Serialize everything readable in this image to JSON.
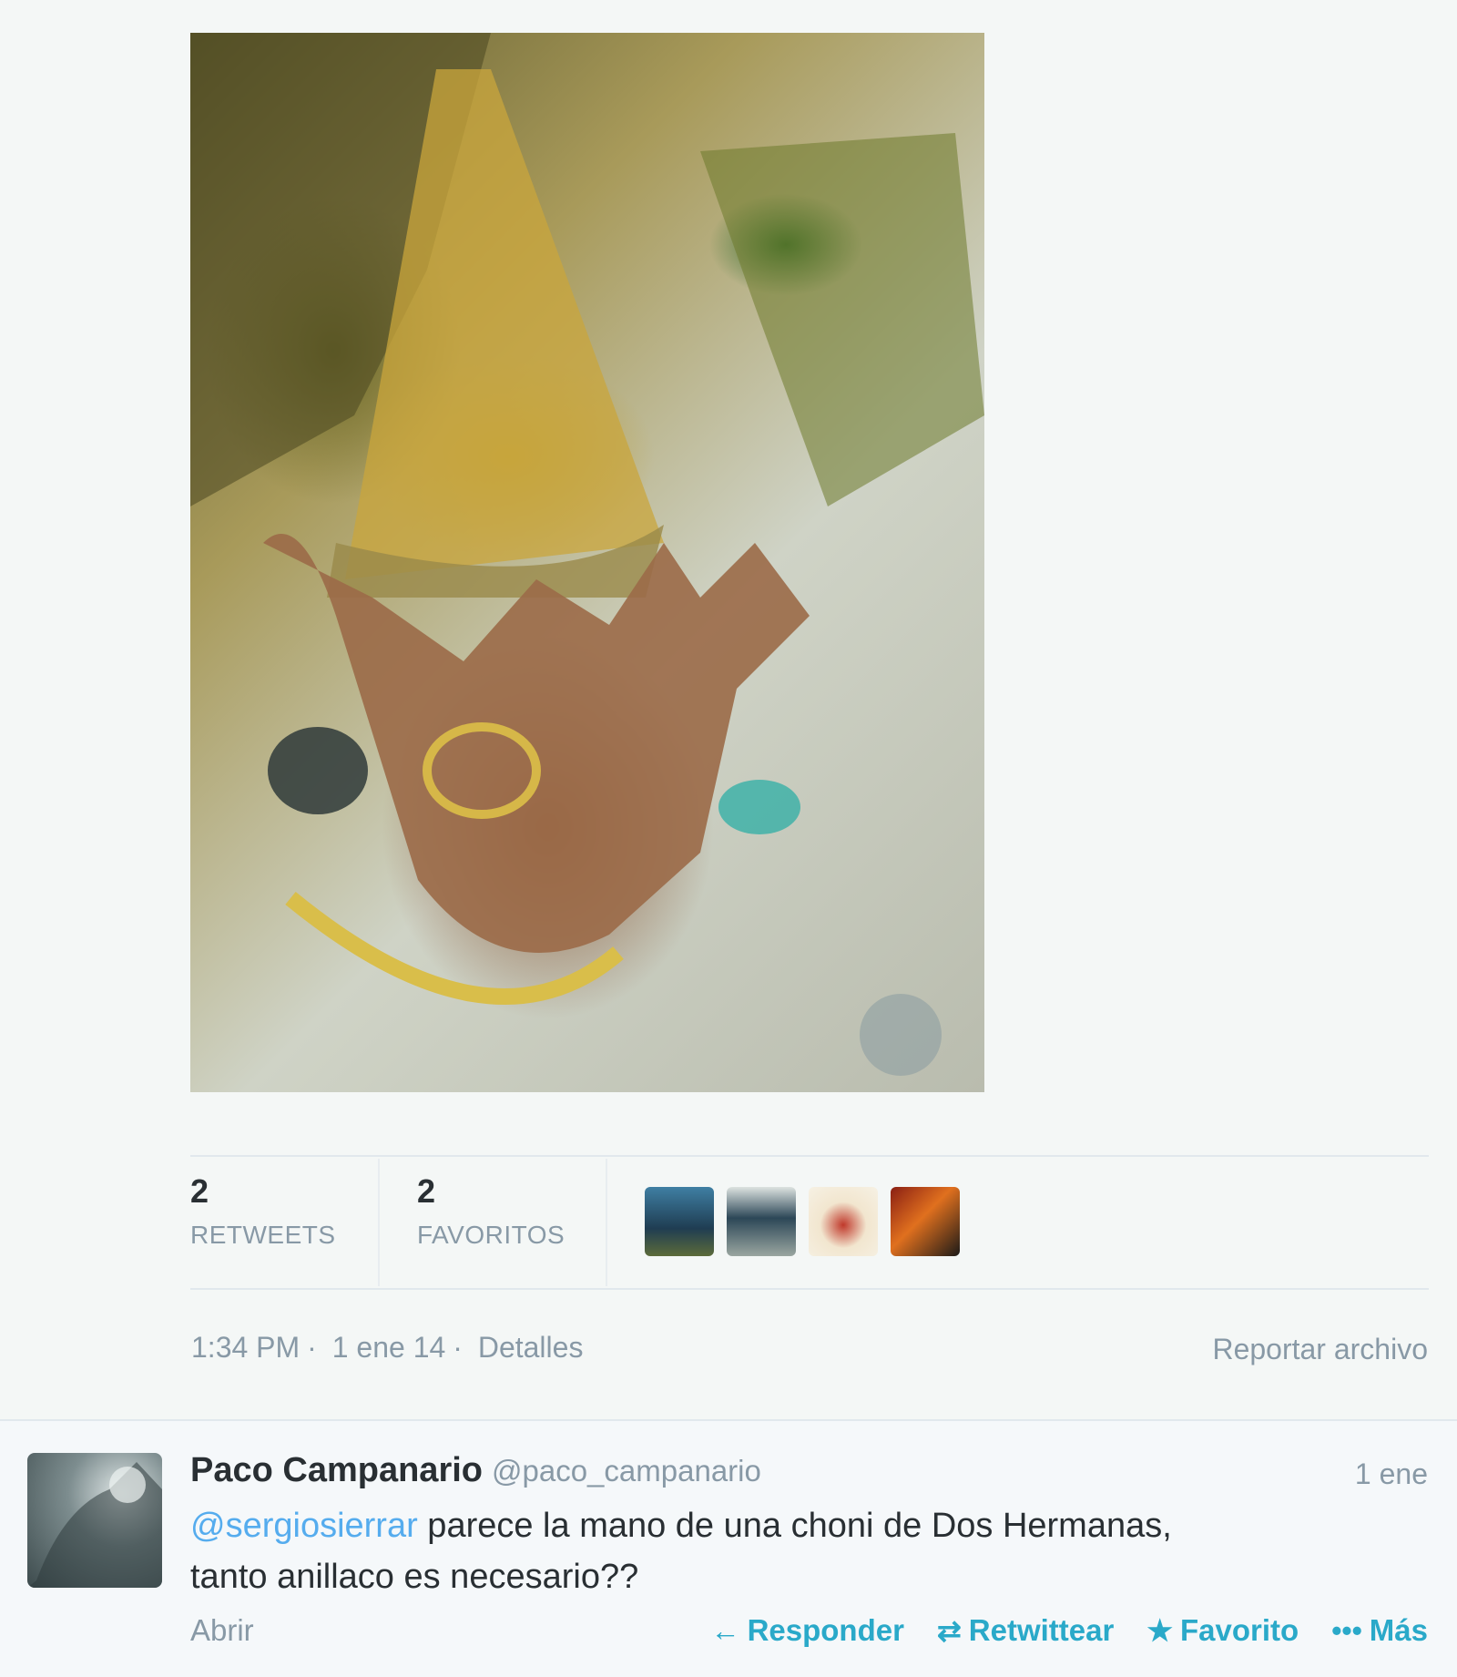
{
  "stats": {
    "retweets": {
      "count": "2",
      "label": "RETWEETS"
    },
    "favorites": {
      "count": "2",
      "label": "FAVORITOS"
    }
  },
  "meta": {
    "time": "1:34 PM",
    "date": "1 ene 14",
    "details": "Detalles",
    "report": "Reportar archivo"
  },
  "reply": {
    "name": "Paco Campanario",
    "handle": "@paco_campanario",
    "time": "1 ene",
    "mention": "@sergiosierrar",
    "text_line1": " parece la mano de una choni de Dos Hermanas,",
    "text_line2": "tanto anillaco es necesario??",
    "open": "Abrir",
    "actions": {
      "reply": "Responder",
      "retweet": "Retwittear",
      "favorite": "Favorito",
      "more": "Más"
    },
    "icons": {
      "reply": "arrow-left-icon",
      "retweet": "retweet-icon",
      "favorite": "star-icon",
      "more": "ellipsis-icon"
    }
  },
  "colors": {
    "link": "#55acee",
    "action": "#2aa9c9",
    "muted": "#8899a6"
  }
}
